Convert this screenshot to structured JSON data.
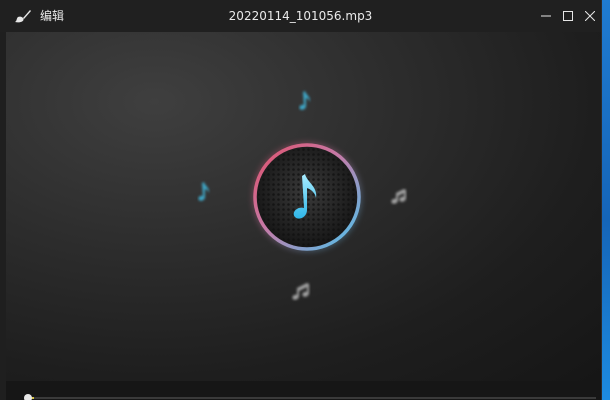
{
  "window": {
    "title": "20220114_101056.mp3",
    "edit_label": "编辑"
  },
  "icons": {
    "app": "paintbrush-icon",
    "minimize": "minimize-icon",
    "maximize": "maximize-icon",
    "close": "close-icon",
    "center": "music-note-icon"
  },
  "player": {
    "progress": 0.01
  },
  "colors": {
    "ring_start": "#e0506a",
    "ring_end": "#49c6f0",
    "note": "#4fc8ef",
    "progress": "#d8c44a"
  }
}
